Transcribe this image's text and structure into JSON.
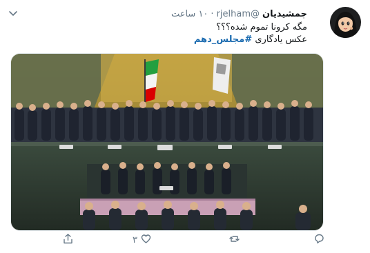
{
  "tweet": {
    "author_name": "جمشیدیان",
    "handle": "@rjelham",
    "separator": "·",
    "time": "۱۰ ساعت",
    "text_line1": "مگه کرونا تموم شده؟؟؟",
    "text_line2_prefix": "عکس یادگاری",
    "hashtag": "#مجلس_دهم"
  },
  "actions": {
    "like_count": "۳"
  },
  "colors": {
    "accent": "#1b6bb0",
    "secondary_text": "#657786",
    "name_text": "#14171a"
  },
  "icons": [
    "chevron-down-icon",
    "reply-icon",
    "retweet-icon",
    "like-icon",
    "share-icon"
  ]
}
